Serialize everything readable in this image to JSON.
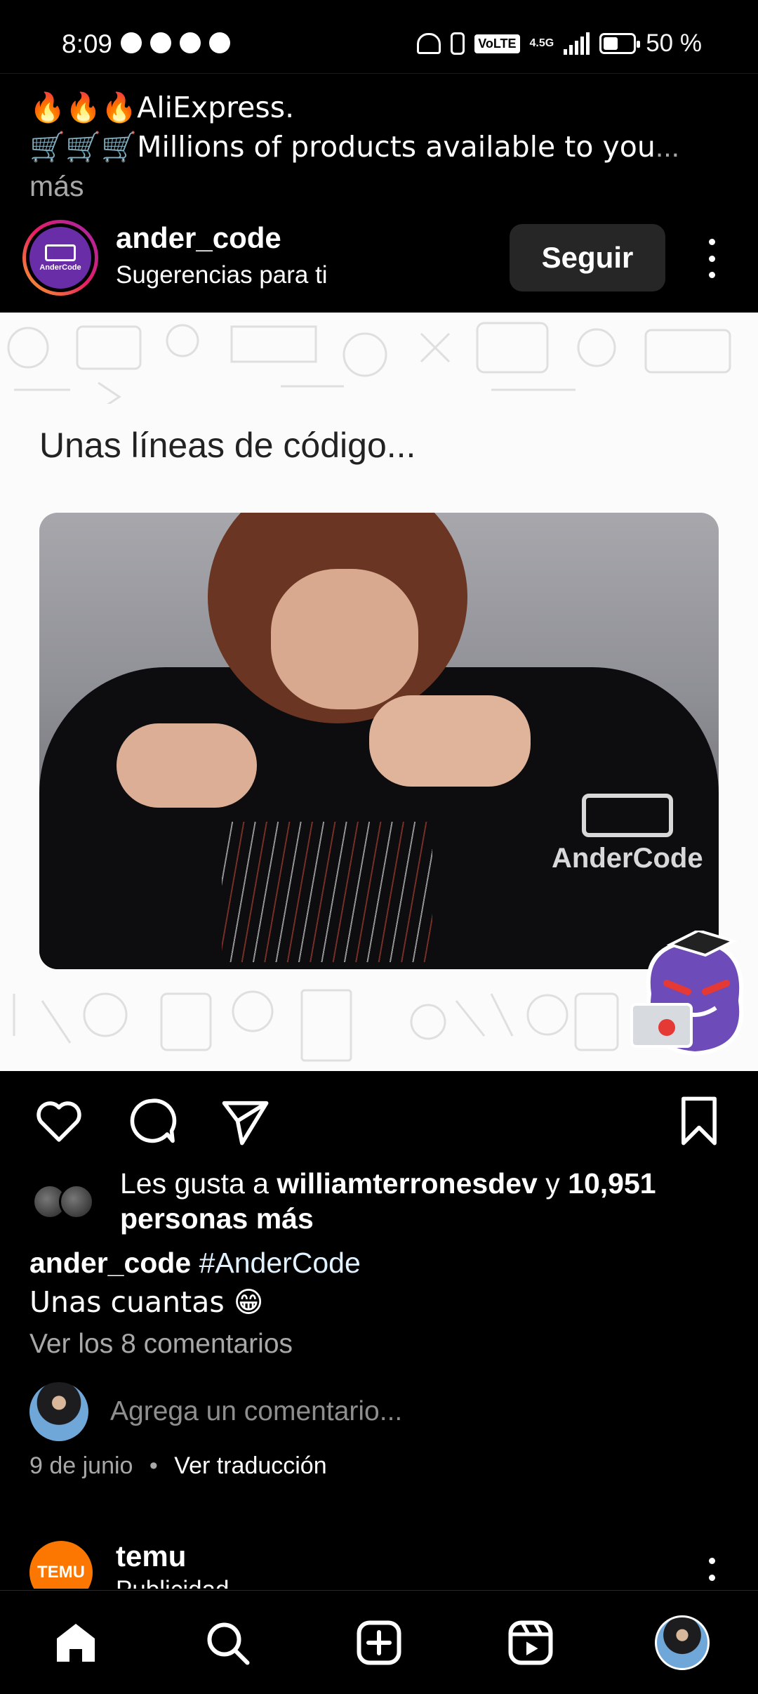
{
  "status_bar": {
    "time": "8:09",
    "network": "4.5G",
    "volte": "VoLTE",
    "battery": "50 %",
    "battery_level": 0.5
  },
  "prior_post": {
    "line1": "🔥🔥🔥AliExpress.",
    "line2": "🛒🛒🛒Millions of products available to you",
    "ellipsis": "...",
    "more": "más"
  },
  "post": {
    "username": "ander_code",
    "subtitle": "Sugerencias para ti",
    "follow_label": "Seguir",
    "avatar_text": "AnderCode",
    "image": {
      "heading": "Unas líneas de código...",
      "watermark": "AnderCode"
    },
    "likes": {
      "prefix": "Les gusta a",
      "user": "williamterronesdev",
      "middle": "y",
      "count": "10,951",
      "suffix": "personas más"
    },
    "caption": {
      "user": "ander_code",
      "hashtag": "#AnderCode",
      "text": "Unas cuantas 😁"
    },
    "view_comments": "Ver los 8 comentarios",
    "comment_placeholder": "Agrega un comentario...",
    "date": "9 de junio",
    "separator": "•",
    "translate": "Ver traducción"
  },
  "next_post": {
    "username": "temu",
    "subtitle": "Publicidad",
    "avatar_text": "TEMU"
  },
  "nav": {
    "items": [
      "home-icon",
      "search-icon",
      "create-icon",
      "reels-icon",
      "profile-avatar"
    ]
  },
  "colors": {
    "background": "#000000",
    "follow_button": "#262626",
    "secondary_text": "#a8a8a8",
    "temu_orange": "#fb7701"
  }
}
